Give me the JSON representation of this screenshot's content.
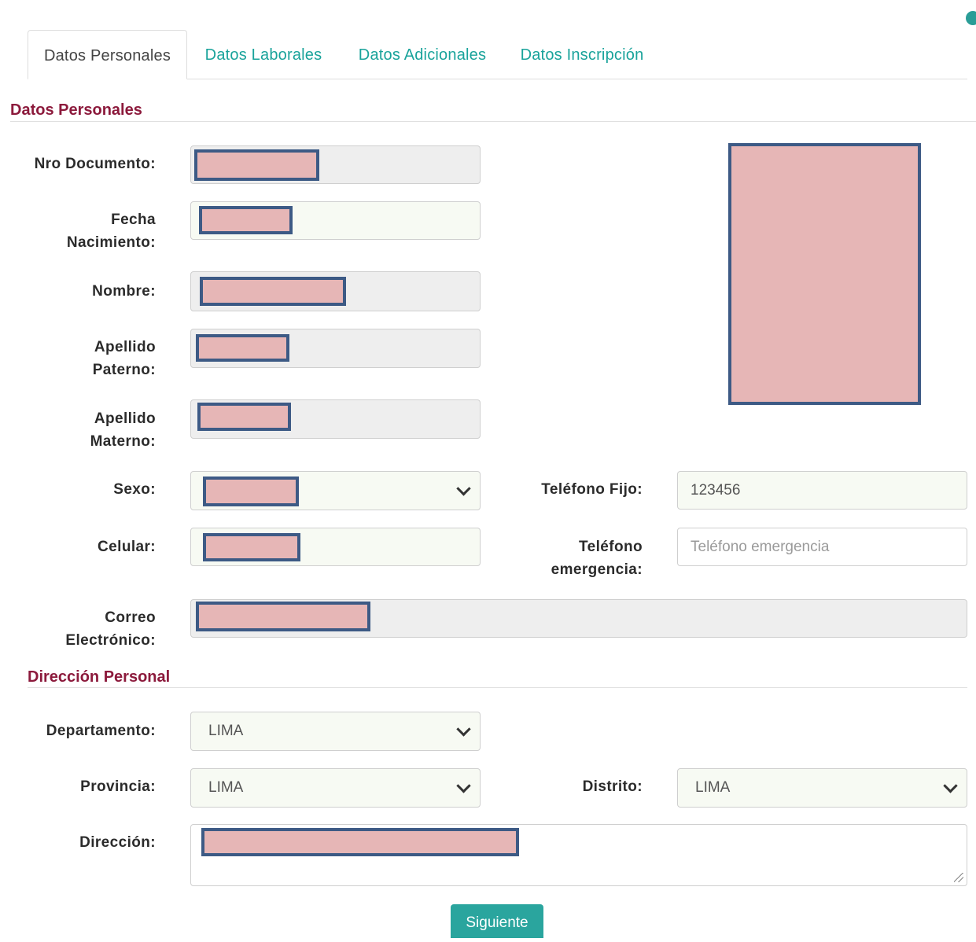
{
  "tabs": [
    {
      "label": "Datos Personales",
      "active": true
    },
    {
      "label": "Datos Laborales",
      "active": false
    },
    {
      "label": "Datos Adicionales",
      "active": false
    },
    {
      "label": "Datos Inscripción",
      "active": false
    }
  ],
  "personal": {
    "section_title": "Datos Personales",
    "nro_documento_label": "Nro Documento:",
    "fecha_label_1": "Fecha",
    "fecha_label_2": "Nacimiento:",
    "nombre_label": "Nombre:",
    "ap_paterno_label_1": "Apellido",
    "ap_paterno_label_2": "Paterno:",
    "ap_materno_label_1": "Apellido",
    "ap_materno_label_2": "Materno:",
    "sexo_label": "Sexo:",
    "telefono_fijo_label": "Teléfono Fijo:",
    "telefono_fijo_value": "123456",
    "celular_label": "Celular:",
    "telefono_emergencia_label_1": "Teléfono",
    "telefono_emergencia_label_2": "emergencia:",
    "telefono_emergencia_placeholder": "Teléfono emergencia",
    "correo_label_1": "Correo",
    "correo_label_2": "Electrónico:"
  },
  "address": {
    "section_title": "Dirección Personal",
    "departamento_label": "Departamento:",
    "departamento_value": "LIMA",
    "provincia_label": "Provincia:",
    "provincia_value": "LIMA",
    "distrito_label": "Distrito:",
    "distrito_value": "LIMA",
    "direccion_label": "Dirección:"
  },
  "actions": {
    "next_label": "Siguiente"
  },
  "colors": {
    "accent": "#2aa59e",
    "section_title": "#8c1a3c",
    "redaction_fill": "#e6b6b6",
    "redaction_border": "#3d5a85"
  }
}
